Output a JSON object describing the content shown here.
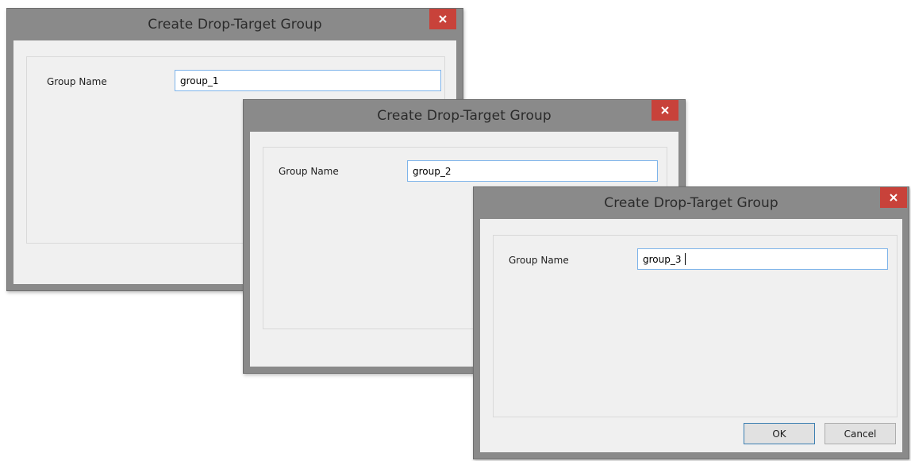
{
  "dialogs": [
    {
      "title": "Create Drop-Target Group",
      "group_name_label": "Group Name",
      "group_name_value": "group_1",
      "close_icon": "close-icon"
    },
    {
      "title": "Create Drop-Target Group",
      "group_name_label": "Group Name",
      "group_name_value": "group_2",
      "close_icon": "close-icon"
    },
    {
      "title": "Create Drop-Target Group",
      "group_name_label": "Group Name",
      "group_name_value": "group_3",
      "close_icon": "close-icon",
      "ok_label": "OK",
      "cancel_label": "Cancel"
    }
  ],
  "colors": {
    "frame": "#8a8a8a",
    "client": "#f0f0f0",
    "close_button": "#c8423a",
    "input_border": "#7eb4ea",
    "default_button_border": "#3c7fb1"
  }
}
